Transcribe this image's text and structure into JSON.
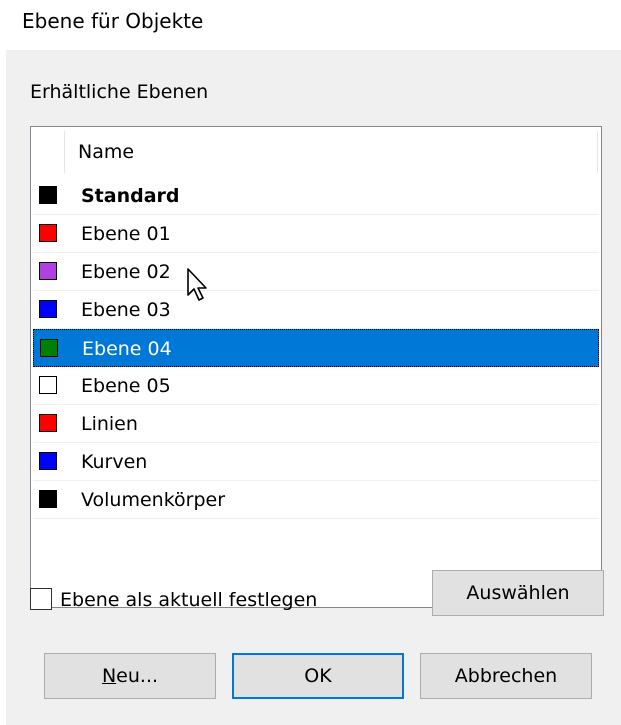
{
  "window": {
    "title": "Ebene für Objekte"
  },
  "group": {
    "label": "Erhältliche Ebenen"
  },
  "list": {
    "column_name": "Name",
    "items": [
      {
        "label": "Standard",
        "color": "#000000",
        "bold": true
      },
      {
        "label": "Ebene 01",
        "color": "#ff0000"
      },
      {
        "label": "Ebene 02",
        "color": "#b040e0"
      },
      {
        "label": "Ebene 03",
        "color": "#0000ff"
      },
      {
        "label": "Ebene 04",
        "color": "#008000",
        "selected": true
      },
      {
        "label": "Ebene 05",
        "color": "#ffffff"
      },
      {
        "label": "Linien",
        "color": "#ff0000"
      },
      {
        "label": "Kurven",
        "color": "#0000ff"
      },
      {
        "label": "Volumenkörper",
        "color": "#000000"
      }
    ]
  },
  "options": {
    "set_current_label": "Ebene als aktuell festlegen",
    "set_current_checked": false
  },
  "buttons": {
    "select": "Auswählen",
    "new_accel": "N",
    "new_rest": "eu...",
    "ok": "OK",
    "cancel": "Abbrechen"
  },
  "colors": {
    "selection": "#0078d7",
    "dialog_bg": "#f0f0f0",
    "button_bg": "#e1e1e1"
  }
}
